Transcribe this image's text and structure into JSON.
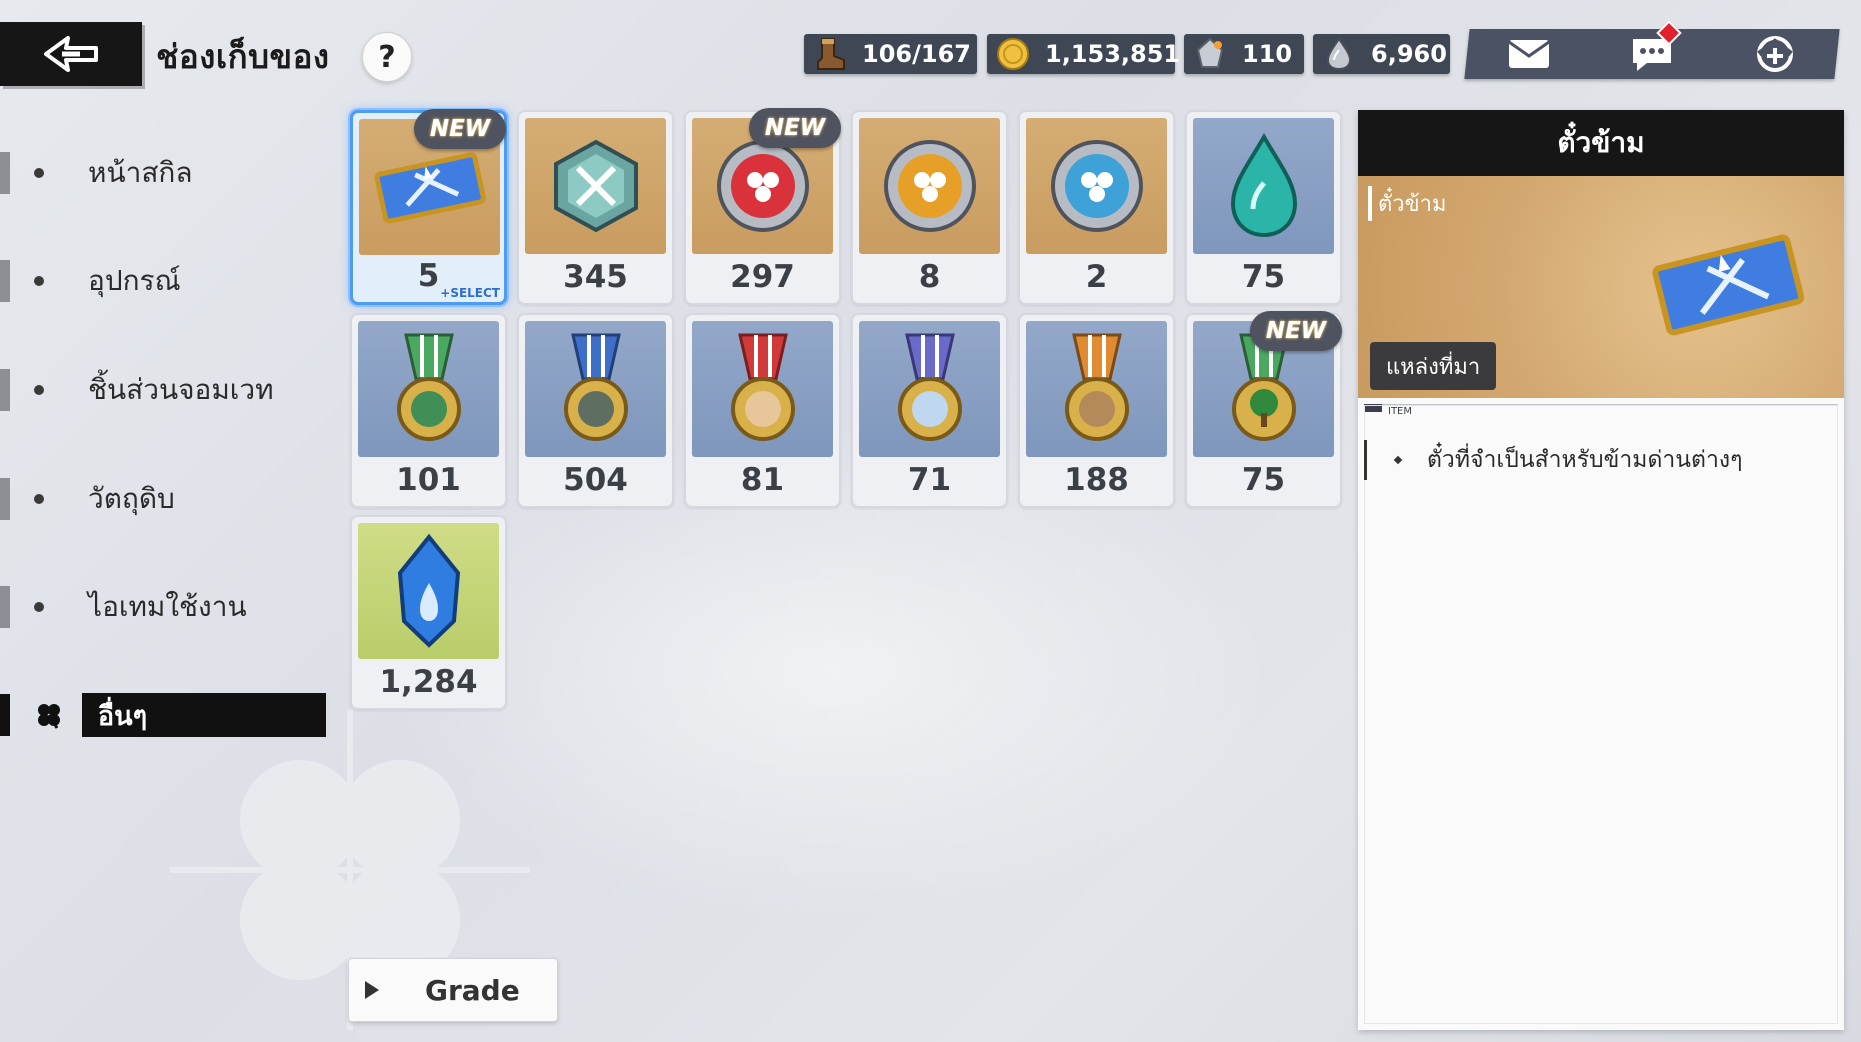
{
  "header": {
    "title": "ช่องเก็บของ",
    "help_label": "?"
  },
  "resources": [
    {
      "name": "stamina",
      "icon": "boot-icon",
      "value": "106/167"
    },
    {
      "name": "gold",
      "icon": "gold-coin-icon",
      "value": "1,153,851"
    },
    {
      "name": "crystal-ticket",
      "icon": "crystal-coin-icon",
      "value": "110"
    },
    {
      "name": "gem",
      "icon": "silver-drop-icon",
      "value": "6,960"
    }
  ],
  "top_actions": [
    {
      "icon": "mail-icon"
    },
    {
      "icon": "chat-icon",
      "notification": true
    },
    {
      "icon": "home-icon"
    }
  ],
  "sidebar": {
    "items": [
      {
        "label": "หน้าสกิล",
        "active": false
      },
      {
        "label": "อุปกรณ์",
        "active": false
      },
      {
        "label": "ชิ้นส่วนจอมเวท",
        "active": false
      },
      {
        "label": "วัตถุดิบ",
        "active": false
      },
      {
        "label": "ไอเทมใช้งาน",
        "active": false
      },
      {
        "label": "อื่นๆ",
        "active": true,
        "icon": "clover-icon"
      }
    ]
  },
  "inventory": {
    "items": [
      {
        "icon": "ticket-icon",
        "bg": "gold",
        "qty": "5",
        "new": true,
        "selected": true,
        "tag": "+SELECT"
      },
      {
        "icon": "crossed-swords-emblem-icon",
        "bg": "gold",
        "qty": "345",
        "new": false
      },
      {
        "icon": "red-clover-medal-icon",
        "bg": "gold",
        "qty": "297",
        "new": true
      },
      {
        "icon": "orange-clover-medal-icon",
        "bg": "gold",
        "qty": "8",
        "new": false
      },
      {
        "icon": "blue-clover-medal-icon",
        "bg": "gold",
        "qty": "2",
        "new": false
      },
      {
        "icon": "teal-drop-icon",
        "bg": "blue",
        "qty": "75",
        "new": false
      },
      {
        "icon": "green-ribbon-medal-icon",
        "bg": "blue",
        "qty": "101",
        "new": false
      },
      {
        "icon": "blue-ribbon-medal-icon",
        "bg": "blue",
        "qty": "504",
        "new": false
      },
      {
        "icon": "red-ribbon-medal-icon",
        "bg": "blue",
        "qty": "81",
        "new": false
      },
      {
        "icon": "purple-ribbon-medal-icon",
        "bg": "blue",
        "qty": "71",
        "new": false
      },
      {
        "icon": "orange-ribbon-medal-icon",
        "bg": "blue",
        "qty": "188",
        "new": false
      },
      {
        "icon": "green-tree-medal-icon",
        "bg": "blue",
        "qty": "75",
        "new": true
      },
      {
        "icon": "blue-crystal-icon",
        "bg": "lime",
        "qty": "1,284",
        "new": false
      }
    ],
    "new_label": "NEW"
  },
  "grade_button": {
    "label": "Grade"
  },
  "detail": {
    "header": "ตั๋วข้าม",
    "item_name": "ตั๋วข้าม",
    "source_button": "แหล่งที่มา",
    "type_label": "ITEM",
    "description": "ตั๋วที่จำเป็นสำหรับข้ามด่านต่างๆ"
  },
  "colors": {
    "accent_select": "#4d9bf2",
    "panel_dark": "#161616",
    "resource_bg": "#3f4654",
    "notif": "#e0202a"
  }
}
